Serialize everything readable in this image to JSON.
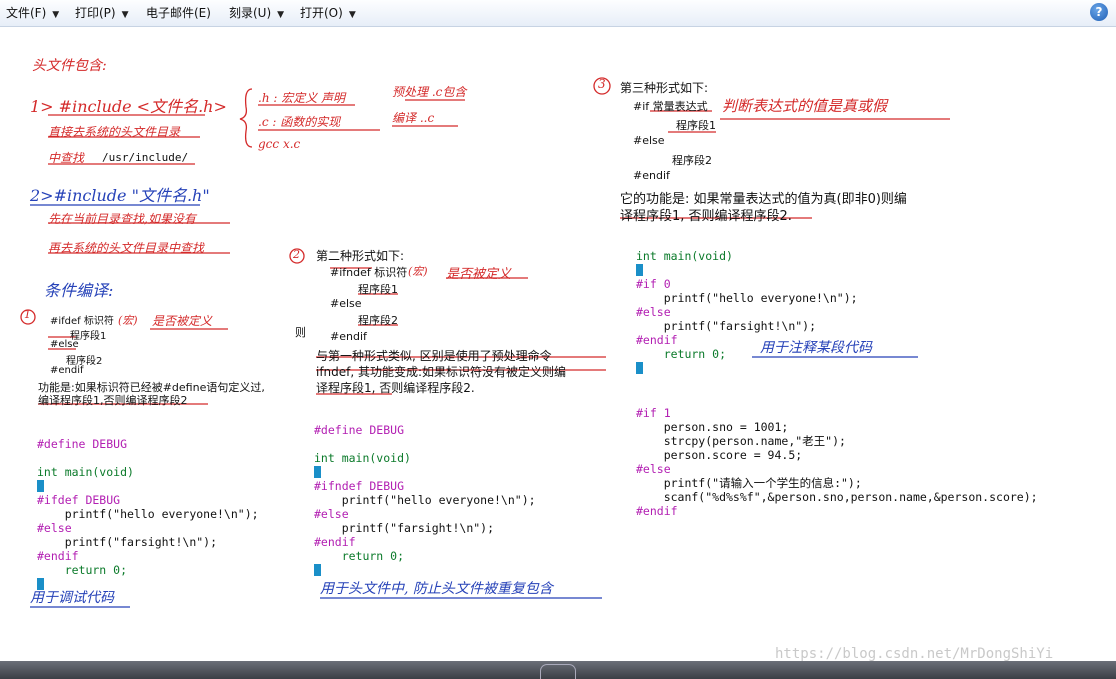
{
  "menu": {
    "file": "文件(F)",
    "print": "打印(P)",
    "email": "电子邮件(E)",
    "burn": "刻录(U)",
    "open": "打开(O)",
    "help_glyph": "?"
  },
  "notes_left": {
    "h1": "头文件包含:",
    "h2": "1> #include <文件名.h>",
    "h3": "直接去系统的头文件目录",
    "h4": "中查找",
    "path": "/usr/include/",
    "h5": "2>#include \"文件名.h\"",
    "h6": "先在当前目录查找,如果没有",
    "h7": "再去系统的头文件目录中查找",
    "h8": "条件编译:",
    "circle1": "1",
    "f1": "#ifdef 标识符",
    "f1_note": "(宏)",
    "f1_comment": "是否被定义",
    "f2": "程序段1",
    "f3": "#else",
    "f4": "程序段2",
    "f5": "#endif",
    "desc1": "功能是:如果标识符已经被#define语句定义过,",
    "desc2": "编译程序段1,否则编译程序段2",
    "code": [
      "#define DEBUG",
      "",
      "int main(void)",
      "{",
      "#ifdef DEBUG",
      "    printf(\"hello everyone!\\n\");",
      "#else",
      "    printf(\"farsight!\\n\");",
      "#endif",
      "    return 0;",
      "}"
    ],
    "note_bottom": "用于调试代码"
  },
  "notes_mid_top": {
    "a1": ".h : 宏定义 声明",
    "a2": ".c : 函数的实现",
    "a3": "gcc x.c",
    "b1": "预处理 .c包含",
    "b2": "编译 ..c"
  },
  "notes_mid": {
    "circle2": "2",
    "title": "第二种形式如下:",
    "f1": "#ifndef 标识符",
    "f1_note": "(宏)",
    "f1_comment": "是否被定义",
    "f2": "程序段1",
    "f3": "#else",
    "f4": "程序段2",
    "f5": "#endif",
    "side": "则",
    "desc1": "与第一种形式类似, 区别是使用了预处理命令",
    "desc2": "ifndef, 其功能变成:如果标识符没有被定义则编",
    "desc3": "译程序段1, 否则编译程序段2.",
    "code": [
      "#define DEBUG",
      "",
      "int main(void)",
      "{",
      "#ifndef DEBUG",
      "    printf(\"hello everyone!\\n\");",
      "#else",
      "    printf(\"farsight!\\n\");",
      "#endif",
      "    return 0;",
      "}"
    ],
    "note_bottom": "用于头文件中, 防止头文件被重复包含"
  },
  "notes_right": {
    "circle3": "3",
    "title": "第三种形式如下:",
    "f1": "#if 常量表达式",
    "f1_comment": "判断表达式的值是真或假",
    "f2": "程序段1",
    "f3": "#else",
    "f4": "程序段2",
    "f5": "#endif",
    "desc1": "它的功能是: 如果常量表达式的值为真(即非0)则编",
    "desc2": "译程序段1, 否则编译程序段2.",
    "code1": [
      "int main(void)",
      "{",
      "#if 0",
      "    printf(\"hello everyone!\\n\");",
      "#else",
      "    printf(\"farsight!\\n\");",
      "#endif",
      "    return 0;",
      "}"
    ],
    "code1_note": "用于注释某段代码",
    "code2": [
      "#if 1",
      "    person.sno = 1001;",
      "    strcpy(person.name,\"老王\");",
      "    person.score = 94.5;",
      "#else",
      "    printf(\"请输入一个学生的信息:\");",
      "    scanf(\"%d%s%f\",&person.sno,person.name,&person.score);",
      "#endif"
    ]
  },
  "watermark": "https://blog.csdn.net/MrDongShiYi",
  "colors": {
    "ink_red": "#d42a2a",
    "ink_blue": "#2642b8",
    "keyword": "#b21eb2",
    "type": "#0b7a2a"
  }
}
